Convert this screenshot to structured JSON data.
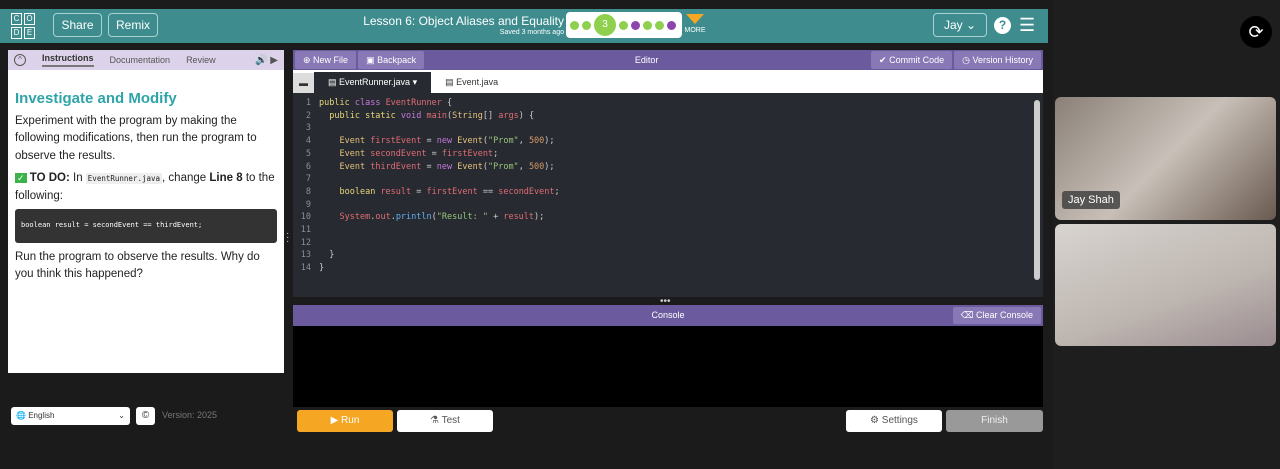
{
  "header": {
    "logo": [
      "C",
      "O",
      "D",
      "E"
    ],
    "share": "Share",
    "remix": "Remix",
    "lesson_title": "Lesson 6: Object Aliases and Equality",
    "saved": "Saved 3 months ago",
    "current_level": "3",
    "more": "MORE",
    "user": "Jay",
    "help": "?"
  },
  "progress_colors": [
    "#8fd14f",
    "#8fd14f",
    "current",
    "#8fd14f",
    "#8e44ad",
    "#8fd14f",
    "#8fd14f",
    "#8e44ad"
  ],
  "instructions": {
    "tabs": [
      "Instructions",
      "Documentation",
      "Review"
    ],
    "title": "Investigate and Modify",
    "intro": "Experiment with the program by making the following modifications, then run the program to observe the results.",
    "todo_label": "TO DO:",
    "todo_in": "In",
    "todo_file": "EventRunner.java",
    "todo_mid": ", change",
    "todo_line": "Line 8",
    "todo_end": "to the following:",
    "snippet": "boolean result = secondEvent == thirdEvent;",
    "question": "Run the program to observe the results. Why do you think this happened?"
  },
  "editor": {
    "new_file": "New File",
    "backpack": "Backpack",
    "title": "Editor",
    "commit": "Commit Code",
    "history": "Version History",
    "files": [
      "EventRunner.java",
      "Event.java"
    ]
  },
  "console": {
    "title": "Console",
    "clear": "Clear Console"
  },
  "footer": {
    "language": "English",
    "version": "Version: 2025",
    "run": "Run",
    "test": "Test",
    "settings": "Settings",
    "finish": "Finish"
  },
  "video": {
    "participant": "Jay Shah"
  }
}
